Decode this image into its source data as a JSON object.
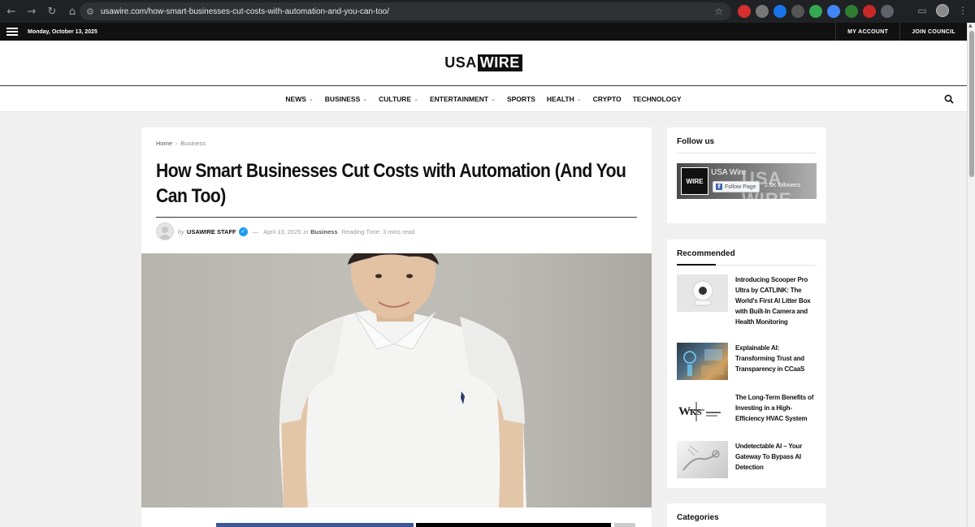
{
  "browser": {
    "url": "usawire.com/how-smart-businesses-cut-costs-with-automation-and-you-can-too/"
  },
  "topbar": {
    "date": "Monday, October 13, 2025",
    "my_account": "MY ACCOUNT",
    "join_council": "JOIN COUNCIL"
  },
  "logo": {
    "part1": "USA",
    "part2": "WIRE"
  },
  "nav": {
    "items": [
      {
        "label": "NEWS",
        "dropdown": true
      },
      {
        "label": "BUSINESS",
        "dropdown": true
      },
      {
        "label": "CULTURE",
        "dropdown": true
      },
      {
        "label": "ENTERTAINMENT",
        "dropdown": true
      },
      {
        "label": "SPORTS",
        "dropdown": false
      },
      {
        "label": "HEALTH",
        "dropdown": true
      },
      {
        "label": "CRYPTO",
        "dropdown": false
      },
      {
        "label": "TECHNOLOGY",
        "dropdown": false
      }
    ]
  },
  "article": {
    "breadcrumb": {
      "home": "Home",
      "separator": "›",
      "category": "Business"
    },
    "title": "How Smart Businesses Cut Costs with Automation (And You Can Too)",
    "meta": {
      "by": "by",
      "author": "USAWIRE STAFF",
      "dash": "—",
      "date": "April 13, 2025",
      "in": "in",
      "category": "Business",
      "reading_time": "Reading Time: 3 mins read"
    }
  },
  "sidebar": {
    "follow": {
      "title": "Follow us",
      "page_name": "USA Wire",
      "logo_text": "WIRE",
      "watermark": "USA WIRE",
      "follow_button": "Follow Page",
      "followers": "2.6K followers"
    },
    "recommended": {
      "title": "Recommended",
      "items": [
        {
          "title": "Introducing Scooper Pro Ultra by CATLINK: The World's First AI Litter Box with Built-In Camera and Health Monitoring"
        },
        {
          "title": "Explainable AI: Transforming Trust and Transparency in CCaaS"
        },
        {
          "title": "The Long-Term Benefits of Investing in a High-Efficiency HVAC System"
        },
        {
          "title": "Undetectable AI – Your Gateway To Bypass AI Detection"
        }
      ]
    },
    "categories": {
      "title": "Categories"
    }
  },
  "colors": {
    "facebook": "#3b5998",
    "verified": "#1d9bf0",
    "topbar": "#111111"
  }
}
